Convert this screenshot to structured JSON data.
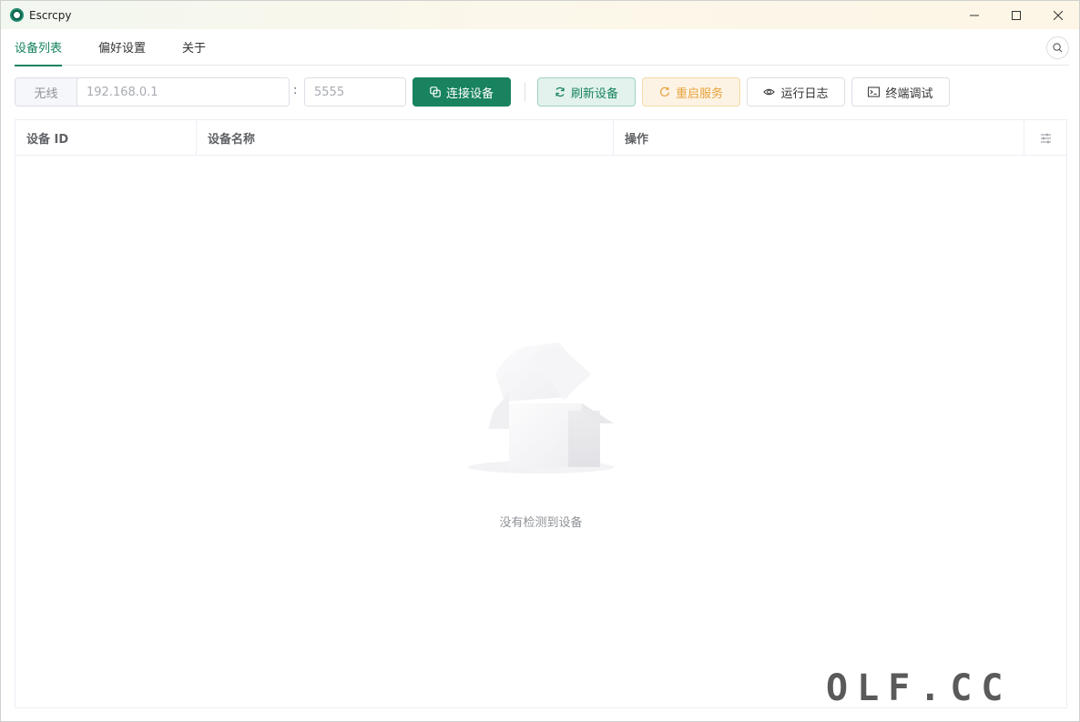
{
  "window": {
    "title": "Escrcpy",
    "controls": [
      "minimize-icon",
      "maximize-icon",
      "close-icon"
    ]
  },
  "tabs": [
    {
      "label": "设备列表",
      "active": true
    },
    {
      "label": "偏好设置",
      "active": false
    },
    {
      "label": "关于",
      "active": false
    }
  ],
  "toolbar": {
    "address_prefix": "无线",
    "address_placeholder": "192.168.0.1",
    "colon": ":",
    "port_placeholder": "5555",
    "connect_label": "连接设备",
    "refresh_label": "刷新设备",
    "restart_label": "重启服务",
    "logs_label": "运行日志",
    "terminal_label": "终端调试"
  },
  "table": {
    "columns": [
      "设备 ID",
      "设备名称",
      "操作"
    ],
    "settings_icon": "sliders-icon",
    "rows": [],
    "empty_text": "没有检测到设备"
  },
  "watermark": "OLF.CC",
  "colors": {
    "primary": "#18835e",
    "warning": "#e6a23c",
    "primary_light_bg": "#e3f2ec",
    "warning_light_bg": "#fdf3e4"
  }
}
